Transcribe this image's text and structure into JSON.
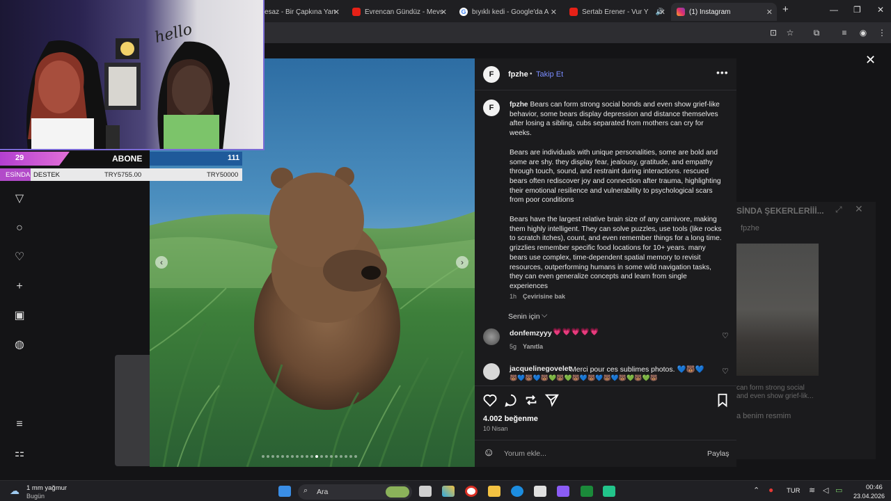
{
  "browser": {
    "tabs": [
      {
        "label": "esaz - Bir Çapkına Yan",
        "favicon": "none"
      },
      {
        "label": "Evrencan Gündüz - Mevs",
        "favicon": "youtube-icon"
      },
      {
        "label": "bıyıklı kedi - Google'da A",
        "favicon": "google-icon"
      },
      {
        "label": "Sertab Erener - Vur Y",
        "favicon": "youtube-icon"
      },
      {
        "label": "(1) Instagram",
        "favicon": "instagram-icon"
      }
    ],
    "accent": "#2d2d31"
  },
  "post": {
    "username": "fpzhe",
    "avatar_letter": "F",
    "follow": "Takip Et",
    "separator": "•",
    "caption_paragraphs": [
      "Bears can form strong social bonds and even show grief-like behavior, some bears display depression and distance themselves after losing a sibling, cubs separated from mothers can cry for weeks.",
      "Bears are individuals with unique personalities, some are bold and some are shy. they display fear, jealousy, gratitude, and empathy through touch, sound, and restraint during interactions. rescued bears often rediscover joy and connection after trauma, highlighting their emotional resilience and vulnerability to psychological scars from poor conditions",
      "Bears have the largest relative brain size of any carnivore, making them highly intelligent. They can solve puzzles, use tools (like rocks to scratch itches), count, and even remember things for a long time. grizzlies remember specific food locations for 10+ years. many bears use complex, time-dependent spatial memory to revisit resources, outperforming humans in some wild navigation tasks, they can even generalize concepts and learn from single experiences"
    ],
    "caption_time": "1h",
    "translate": "Çevirisine bak",
    "for_you": "Senin için",
    "comments": [
      {
        "user": "donfemzyyy",
        "text": "💗💗💗💗💗",
        "time": "5g",
        "reply": "Yanıtla"
      },
      {
        "user": "jacquelinegovelet",
        "text": "Merci pour ces sublimes photos. 💙🐻💙",
        "emoji_row": "🐻💙🐻💙🐻💚🐻💚🐻💙🐻💙🐻💙🐻💚🐻💚🐻"
      }
    ],
    "likes": "4.002 beğenme",
    "date": "10 Nisan",
    "comment_placeholder": "Yorum ekle...",
    "share": "Paylaş",
    "carousel_dots": 20
  },
  "background_chat": {
    "title": "SİNDA ŞEKERLERİİİ...",
    "user": "fpzhe",
    "preview_line1": "can form strong social",
    "preview_line2": "and even show grief-lik...",
    "preview_line3": "a benim resmim"
  },
  "stream": {
    "hello": "hello",
    "abone_label": "ABONE",
    "abone_left": "29",
    "abone_right": "111",
    "destek_prefix": "ESİNDA",
    "destek_label": "DESTEK",
    "destek_current": "TRY5755.00",
    "destek_goal": "TRY50000"
  },
  "taskbar": {
    "weather": "1 mm yağmur",
    "weather_sub": "Bugün",
    "search": "Ara",
    "lang": "TUR",
    "time": "00:46",
    "date": "23.04.2026"
  }
}
